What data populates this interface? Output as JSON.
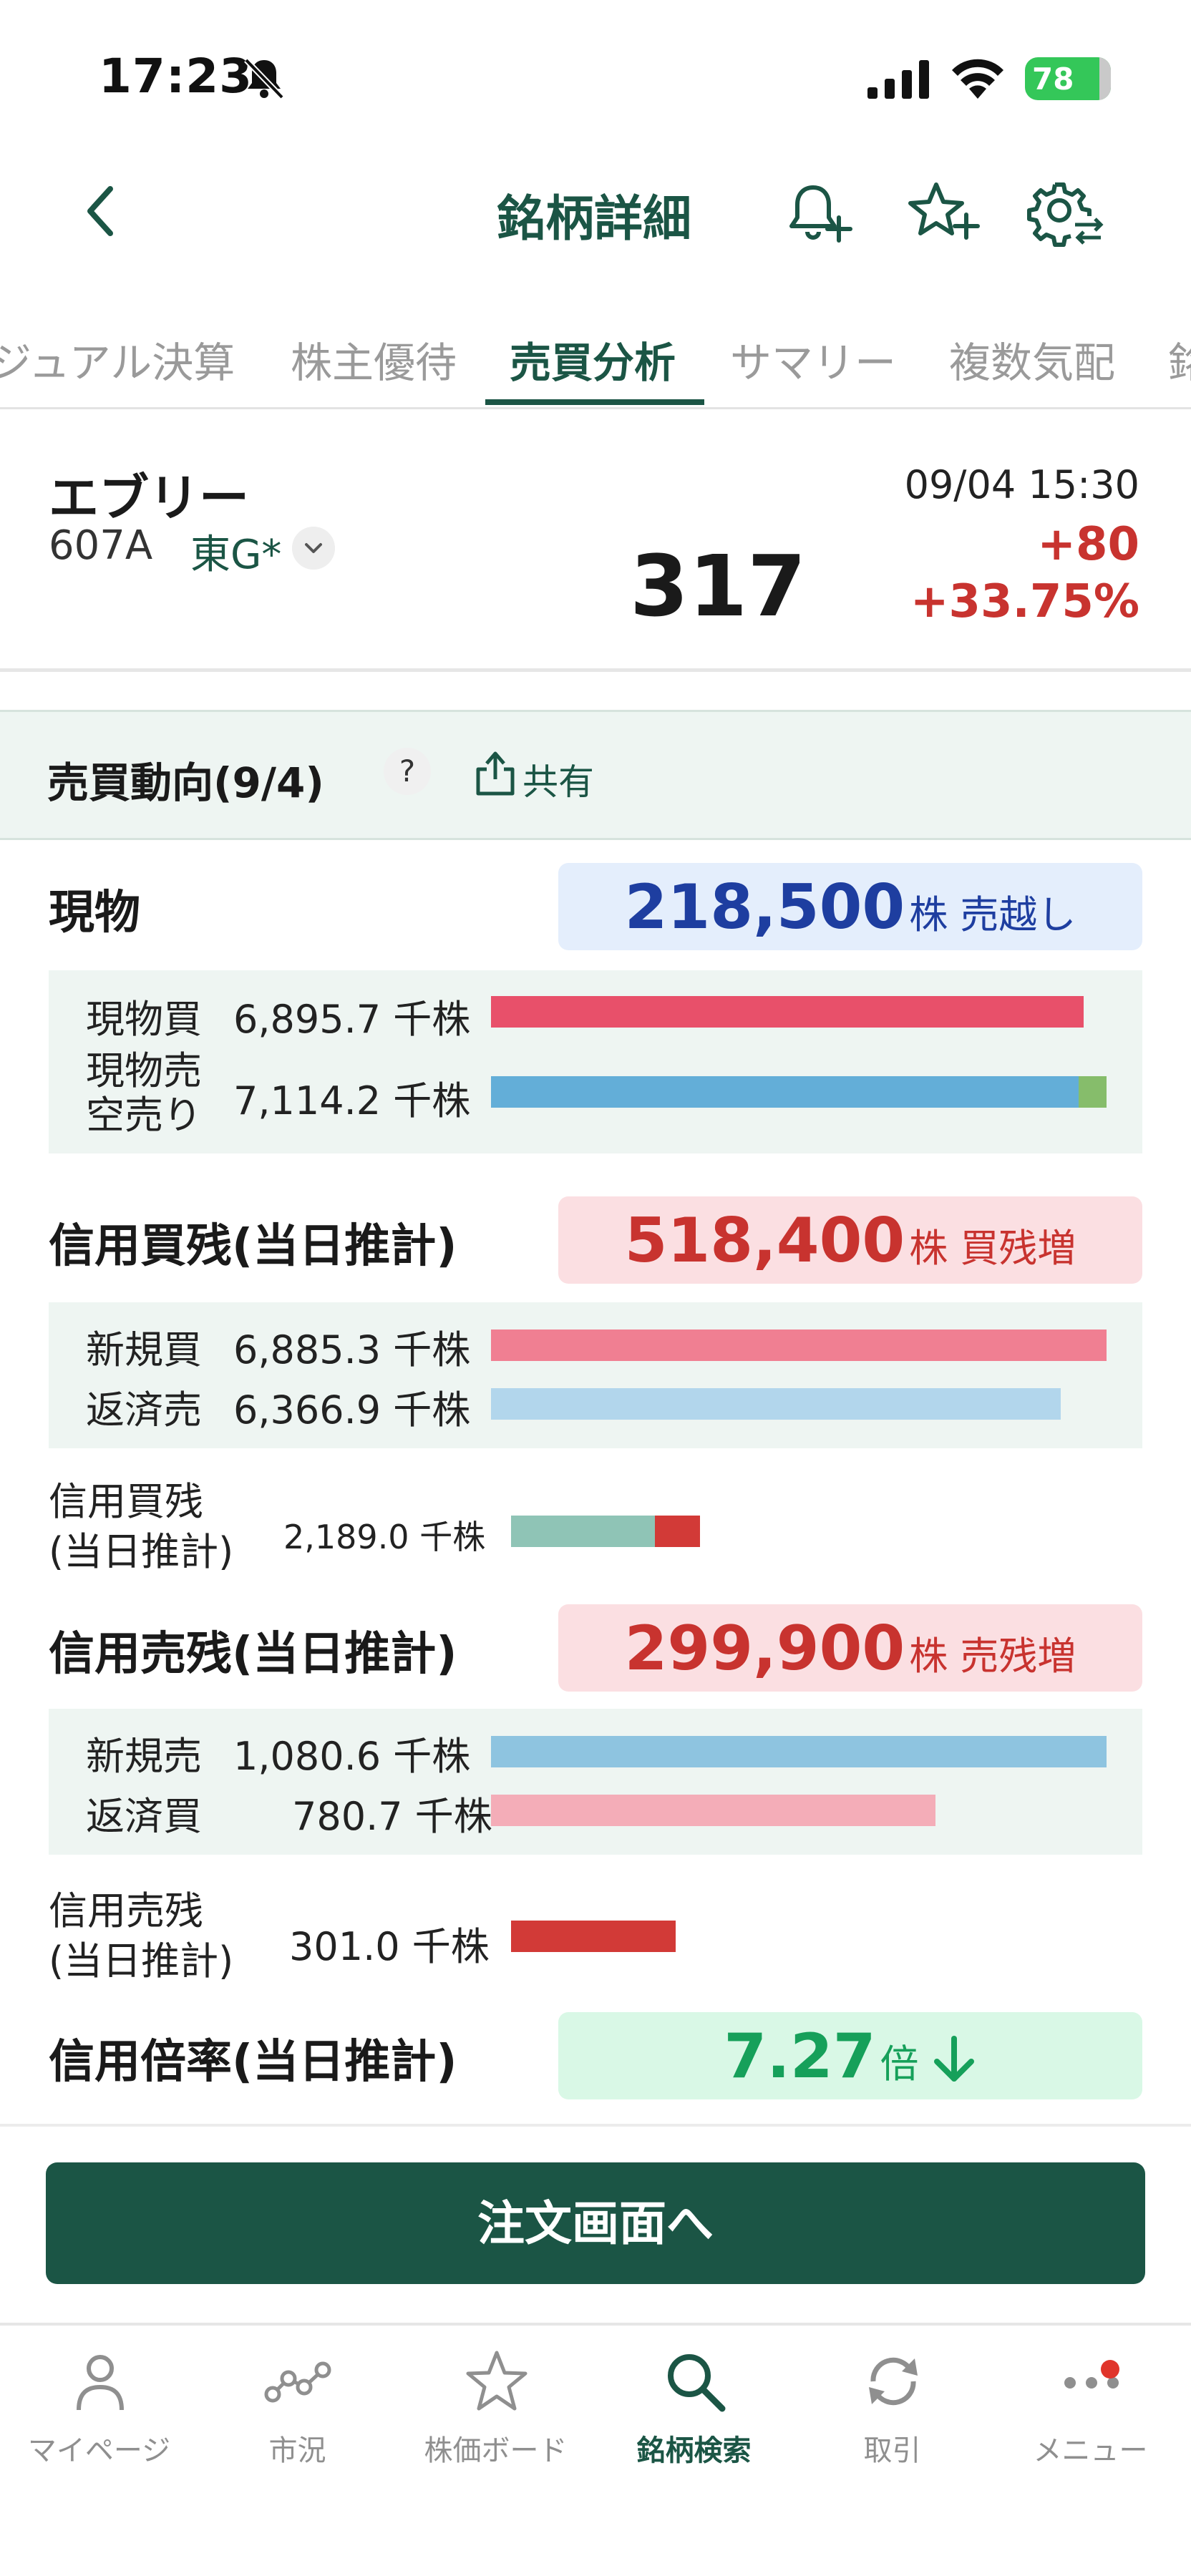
{
  "status_bar": {
    "time": "17:23",
    "battery": "78"
  },
  "header": {
    "title": "銘柄詳細",
    "icons": [
      "back-icon",
      "bell-plus-icon",
      "star-plus-icon",
      "gear-swap-icon"
    ]
  },
  "tabs": [
    {
      "label": "ジュアル決算"
    },
    {
      "label": "株主優待"
    },
    {
      "label": "売買分析",
      "active": true
    },
    {
      "label": "サマリー"
    },
    {
      "label": "複数気配"
    },
    {
      "label": "銘"
    }
  ],
  "stock": {
    "name": "エブリー",
    "code": "607A",
    "market": "東G*",
    "price": "317",
    "datetime": "09/04 15:30",
    "change": "+80",
    "change_pct": "+33.75%"
  },
  "section": {
    "title": "売買動向(9/4)",
    "help": "?",
    "share_label": "共有"
  },
  "genbutsu": {
    "label": "現物",
    "summary_value": "218,500",
    "summary_unit": "株 売越し",
    "rows": [
      {
        "label": "現物買",
        "value": "6,895.7",
        "unit": "千株",
        "fraction": 0.963
      },
      {
        "label": "現物売",
        "label2": "空売り",
        "value": "7,114.2",
        "unit": "千株",
        "fraction": 1.0,
        "short_fraction": 0.045
      }
    ]
  },
  "margin_buy": {
    "label": "信用買残(当日推計)",
    "summary_value": "518,400",
    "summary_unit": "株 買残増",
    "rows": [
      {
        "label": "新規買",
        "value": "6,885.3",
        "unit": "千株",
        "fraction": 1.0
      },
      {
        "label": "返済売",
        "value": "6,366.9",
        "unit": "千株",
        "fraction": 0.925
      }
    ],
    "balance": {
      "label1": "信用買残",
      "label2": "(当日推計)",
      "value": "2,189.0",
      "unit": "千株",
      "base_fraction": 0.76,
      "increase_fraction": 0.24
    }
  },
  "margin_sell": {
    "label": "信用売残(当日推計)",
    "summary_value": "299,900",
    "summary_unit": "株 売残増",
    "rows": [
      {
        "label": "新規売",
        "value": "1,080.6",
        "unit": "千株",
        "fraction": 1.0
      },
      {
        "label": "返済買",
        "value": "780.7",
        "unit": "千株",
        "fraction": 0.722
      }
    ],
    "balance": {
      "label1": "信用売残",
      "label2": "(当日推計)",
      "value": "301.0",
      "unit": "千株"
    }
  },
  "margin_ratio": {
    "label": "信用倍率(当日推計)",
    "value": "7.27",
    "unit": "倍"
  },
  "order_button": "注文画面へ",
  "bottom_nav": [
    {
      "label": "マイページ",
      "icon": "person-icon"
    },
    {
      "label": "市況",
      "icon": "market-line-icon"
    },
    {
      "label": "株価ボード",
      "icon": "star-icon"
    },
    {
      "label": "銘柄検索",
      "icon": "search-icon",
      "active": true
    },
    {
      "label": "取引",
      "icon": "refresh-icon"
    },
    {
      "label": "メニュー",
      "icon": "more-dots-icon"
    }
  ],
  "colors": {
    "brand": "#1b5545",
    "up_red": "#c8332f",
    "sell_blue": "#1e3ea0",
    "ratio_green": "#16a05a",
    "bar_buy": "#e8506a",
    "bar_sell": "#63aed8",
    "bar_short": "#86bd6b",
    "bar_new_buy": "#f07f92",
    "bar_repay_sell": "#b2d6ec",
    "bar_new_sell": "#8ec4e0",
    "bar_repay_buy": "#f4adb8",
    "bar_balance_base": "#8fc4b6",
    "bar_balance_up": "#d23a37"
  }
}
